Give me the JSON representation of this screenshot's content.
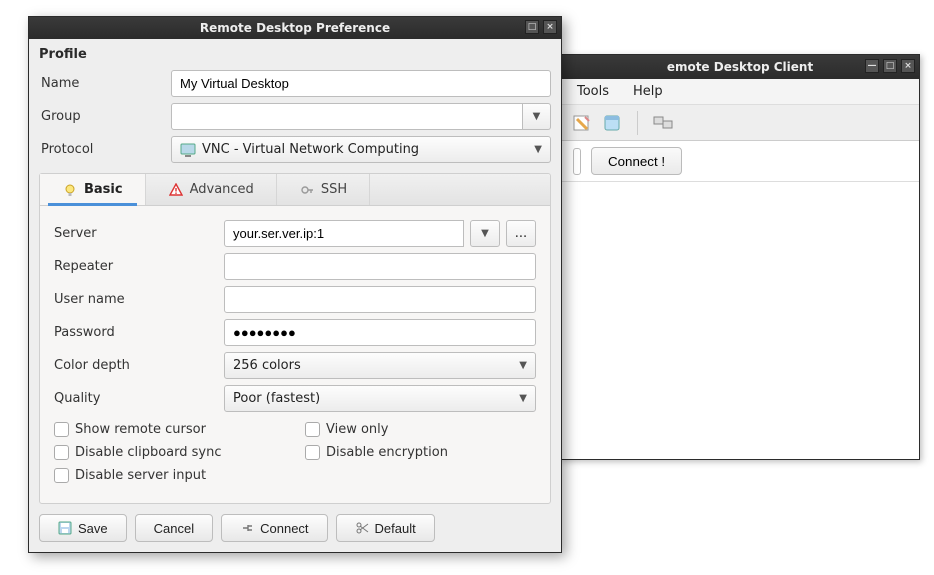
{
  "bgWindow": {
    "title": "emote Desktop Client",
    "menu": {
      "tools": "Tools",
      "help": "Help"
    },
    "connect_label": "Connect !",
    "address_value": ""
  },
  "dialog": {
    "title": "Remote Desktop Preference",
    "profile_section": "Profile",
    "labels": {
      "name": "Name",
      "group": "Group",
      "protocol": "Protocol"
    },
    "values": {
      "name": "My Virtual Desktop",
      "group": "",
      "protocol": "VNC - Virtual Network Computing"
    },
    "tabs": {
      "basic": "Basic",
      "advanced": "Advanced",
      "ssh": "SSH"
    },
    "basic": {
      "labels": {
        "server": "Server",
        "repeater": "Repeater",
        "username": "User name",
        "password": "Password",
        "color_depth": "Color depth",
        "quality": "Quality"
      },
      "values": {
        "server": "your.ser.ver.ip:1",
        "repeater": "",
        "username": "",
        "password": "●●●●●●●●",
        "color_depth": "256 colors",
        "quality": "Poor (fastest)"
      },
      "checkboxes": {
        "show_remote_cursor": "Show remote cursor",
        "view_only": "View only",
        "disable_clipboard_sync": "Disable clipboard sync",
        "disable_encryption": "Disable encryption",
        "disable_server_input": "Disable server input"
      }
    },
    "footer": {
      "save": "Save",
      "cancel": "Cancel",
      "connect": "Connect",
      "default": "Default"
    }
  }
}
